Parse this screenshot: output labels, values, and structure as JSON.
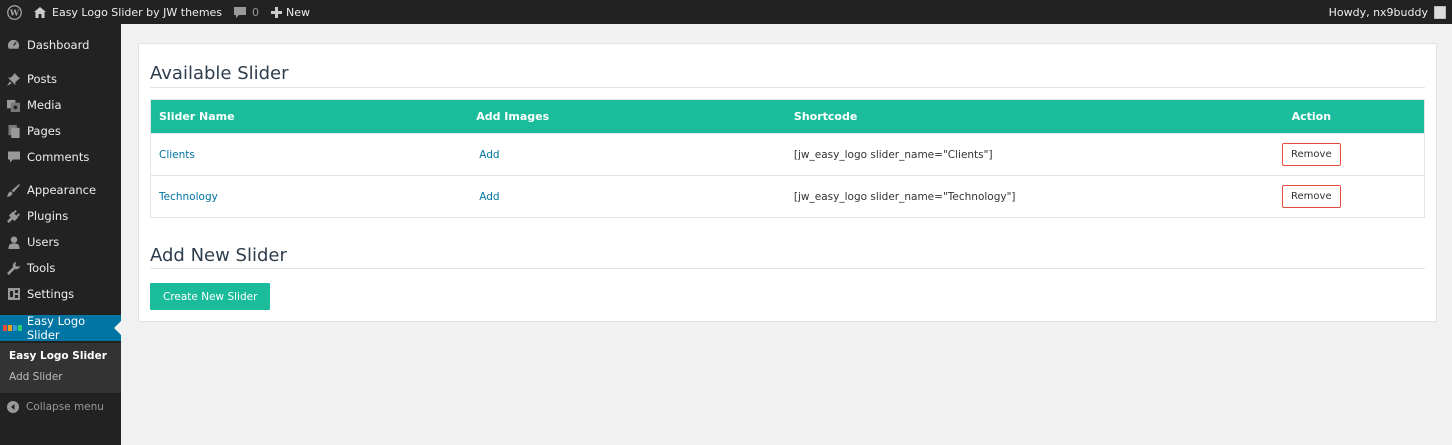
{
  "adminbar": {
    "site_name": "Easy Logo Slider by JW themes",
    "comments_count": "0",
    "new_label": "New",
    "howdy": "Howdy, nx9buddy"
  },
  "sidebar": {
    "items": [
      {
        "label": "Dashboard",
        "icon": "dashboard-icon"
      },
      {
        "label": "Posts",
        "icon": "pin-icon"
      },
      {
        "label": "Media",
        "icon": "media-icon"
      },
      {
        "label": "Pages",
        "icon": "pages-icon"
      },
      {
        "label": "Comments",
        "icon": "comment-icon"
      },
      {
        "label": "Appearance",
        "icon": "brush-icon"
      },
      {
        "label": "Plugins",
        "icon": "plugin-icon"
      },
      {
        "label": "Users",
        "icon": "user-icon"
      },
      {
        "label": "Tools",
        "icon": "wrench-icon"
      },
      {
        "label": "Settings",
        "icon": "settings-icon"
      },
      {
        "label": "Easy Logo Slider",
        "icon": "logo-slider-icon"
      }
    ],
    "submenu": [
      "Easy Logo Slider",
      "Add Slider"
    ],
    "collapse_label": "Collapse menu"
  },
  "main": {
    "available_title": "Available Slider",
    "table": {
      "headers": [
        "Slider Name",
        "Add Images",
        "Shortcode",
        "Action"
      ],
      "rows": [
        {
          "name": "Clients",
          "add": "Add",
          "shortcode": "[jw_easy_logo slider_name=\"Clients\"]",
          "action": "Remove"
        },
        {
          "name": "Technology",
          "add": "Add",
          "shortcode": "[jw_easy_logo slider_name=\"Technology\"]",
          "action": "Remove"
        }
      ]
    },
    "add_new_title": "Add New Slider",
    "create_button": "Create New Slider"
  },
  "colors": {
    "accent": "#1abc9c",
    "admin_dark": "#222222",
    "active_blue": "#0074a2",
    "remove_border": "#e74c3c"
  }
}
